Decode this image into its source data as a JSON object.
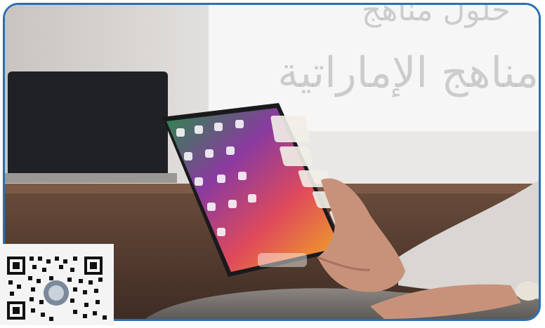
{
  "image": {
    "description_icon": "photo-hand-holding-foldable-tablet",
    "border_color": "#2a6fb0"
  },
  "watermark": {
    "line1": "حلول مناهج",
    "line2": "مناهج الإماراتية"
  },
  "qr": {
    "icon": "qr-code-icon"
  }
}
